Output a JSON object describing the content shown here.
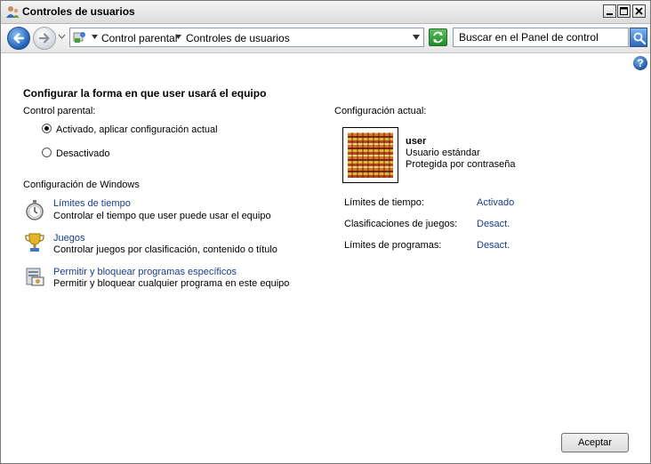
{
  "window": {
    "title": "Controles de usuarios",
    "icon": "user-controls-icon"
  },
  "titlebar_buttons": [
    "minimize-icon",
    "maximize-icon",
    "close-icon"
  ],
  "address_bar": {
    "breadcrumbs": [
      {
        "label": "Control parental"
      },
      {
        "label": "Controles de usuarios"
      }
    ]
  },
  "search": {
    "placeholder": "Buscar en el Panel de control"
  },
  "page": {
    "heading": "Configurar la forma en que user usará el equipo",
    "parental_control_label": "Control parental:",
    "options": [
      {
        "label": "Activado, aplicar configuración actual",
        "selected": true
      },
      {
        "label": "Desactivado",
        "selected": false
      }
    ],
    "windows_settings_label": "Configuración de Windows",
    "settings": [
      {
        "title": "Límites de tiempo",
        "description": "Controlar el tiempo que user puede usar el equipo",
        "icon": "stopwatch-icon"
      },
      {
        "title": "Juegos",
        "description": "Controlar juegos por clasificación, contenido o título",
        "icon": "trophy-icon"
      },
      {
        "title": "Permitir y bloquear programas específicos",
        "description": "Permitir y bloquear cualquier programa en este equipo",
        "icon": "programs-icon"
      }
    ]
  },
  "current": {
    "label": "Configuración actual:",
    "user_name": "user",
    "account_type": "Usuario estándar",
    "password_status": "Protegida por contraseña",
    "rows": [
      {
        "label": "Límites de tiempo:",
        "value": "Activado"
      },
      {
        "label": "Clasificaciones de juegos:",
        "value": "Desact."
      },
      {
        "label": "Límites de programas:",
        "value": "Desact."
      }
    ]
  },
  "buttons": {
    "accept": "Aceptar"
  },
  "colors": {
    "link": "#1a3c8c",
    "accent_blue": "#1d5fb8",
    "refresh_green": "#1f8c2a"
  }
}
